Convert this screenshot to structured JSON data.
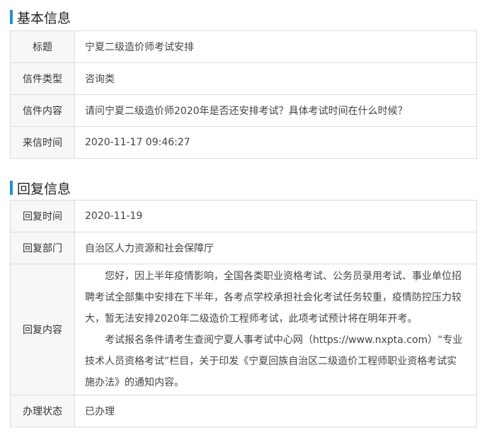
{
  "basic": {
    "heading": "基本信息",
    "rows": [
      {
        "label": "标题",
        "value": "宁夏二级造价师考试安排"
      },
      {
        "label": "信件类型",
        "value": "咨询类"
      },
      {
        "label": "信件内容",
        "value": "请问宁夏二级造价师2020年是否还安排考试？具体考试时间在什么时候？"
      },
      {
        "label": "来信时间",
        "value": "2020-11-17 09:46:27"
      }
    ]
  },
  "reply": {
    "heading": "回复信息",
    "time_label": "回复时间",
    "time_value": "2020-11-19",
    "dept_label": "回复部门",
    "dept_value": "自治区人力资源和社会保障厅",
    "content_label": "回复内容",
    "content_paragraphs": [
      "您好，因上半年疫情影响，全国各类职业资格考试、公务员录用考试、事业单位招聘考试全部集中安排在下半年，各考点学校承担社会化考试任务较重，疫情防控压力较大，暂无法安排2020年二级造价工程师考试，此项考试预计将在明年开考。",
      "考试报名条件请考生查阅宁夏人事考试中心网（https://www.nxpta.com）“专业技术人员资格考试”栏目，关于印发《宁夏回族自治区二级造价工程师职业资格考试实施办法》的通知内容。"
    ],
    "status_label": "办理状态",
    "status_value": "已办理"
  },
  "colors": {
    "accent": "#1e8fe1",
    "border": "#dddddd",
    "label_bg": "#f7f7f7"
  }
}
